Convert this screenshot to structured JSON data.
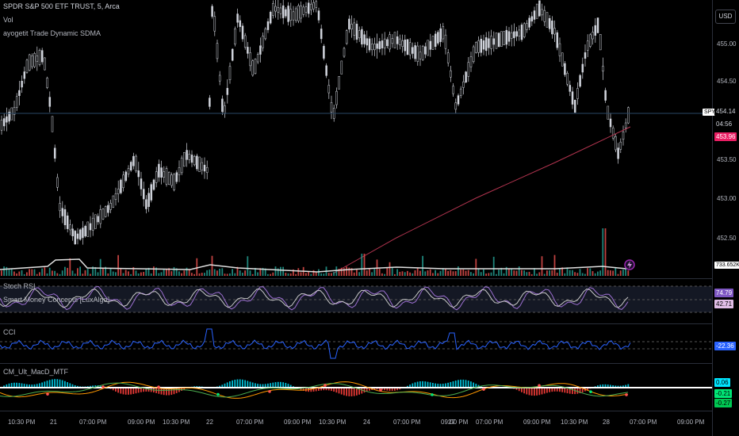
{
  "header": {
    "symbol_title": "SPDR S&P 500 ETF TRUST, 5, Arca",
    "legend_vol": "Vol",
    "legend_sdma": "ayogetit Trade Dynamic SDMA",
    "currency_button": "USD"
  },
  "panes": {
    "stoch_label": "Stoch RSI",
    "smc_label": "Smart Money Concepts [LuxAlgo]",
    "cci_label": "CCI",
    "macd_label": "CM_Ult_MacD_MTF"
  },
  "price_axis": {
    "ticks": [
      "455.00",
      "454.50",
      "453.50",
      "453.00",
      "452.50"
    ],
    "symbol_badge": "SPY",
    "last_price": "454.14",
    "countdown": "04:56",
    "sdma_value": "453.96",
    "volume_value": "733.652K"
  },
  "indicator_values": {
    "stoch_k": "74.79",
    "stoch_d": "42.71",
    "cci": "-22.36",
    "macd_hist": "0.06",
    "macd_line": "-0.21",
    "macd_signal": "-0.27"
  },
  "time_axis": [
    "10:30 PM",
    "21",
    "07:00 PM",
    "09:00 PM",
    "10:30 PM",
    "22",
    "07:00 PM",
    "09:00 PM",
    "10:30 PM",
    "24",
    "07:00 PM",
    "09:00 PM",
    "27",
    "07:00 PM",
    "09:00 PM",
    "10:30 PM",
    "28",
    "07:00 PM",
    "09:00 PM"
  ],
  "colors": {
    "background": "#000000",
    "candle": "#d1d4dc",
    "sdma_line": "#b2344f",
    "volume_up": "#26a69a",
    "volume_down": "#ef5350",
    "stoch_k": "#9c6fd1",
    "stoch_d": "#c8c8c8",
    "cci_line": "#2962ff",
    "macd_zero": "#ffffff",
    "macd_line": "#ff9800",
    "macd_signal": "#4caf50",
    "sdma_badge": "#e91e63",
    "cci_badge": "#2962ff",
    "macd_hist_badge": "#00e5ff",
    "macd_signal_badge": "#00e676"
  },
  "icons": {
    "alert_marker": "lightning-bolt-icon"
  }
}
